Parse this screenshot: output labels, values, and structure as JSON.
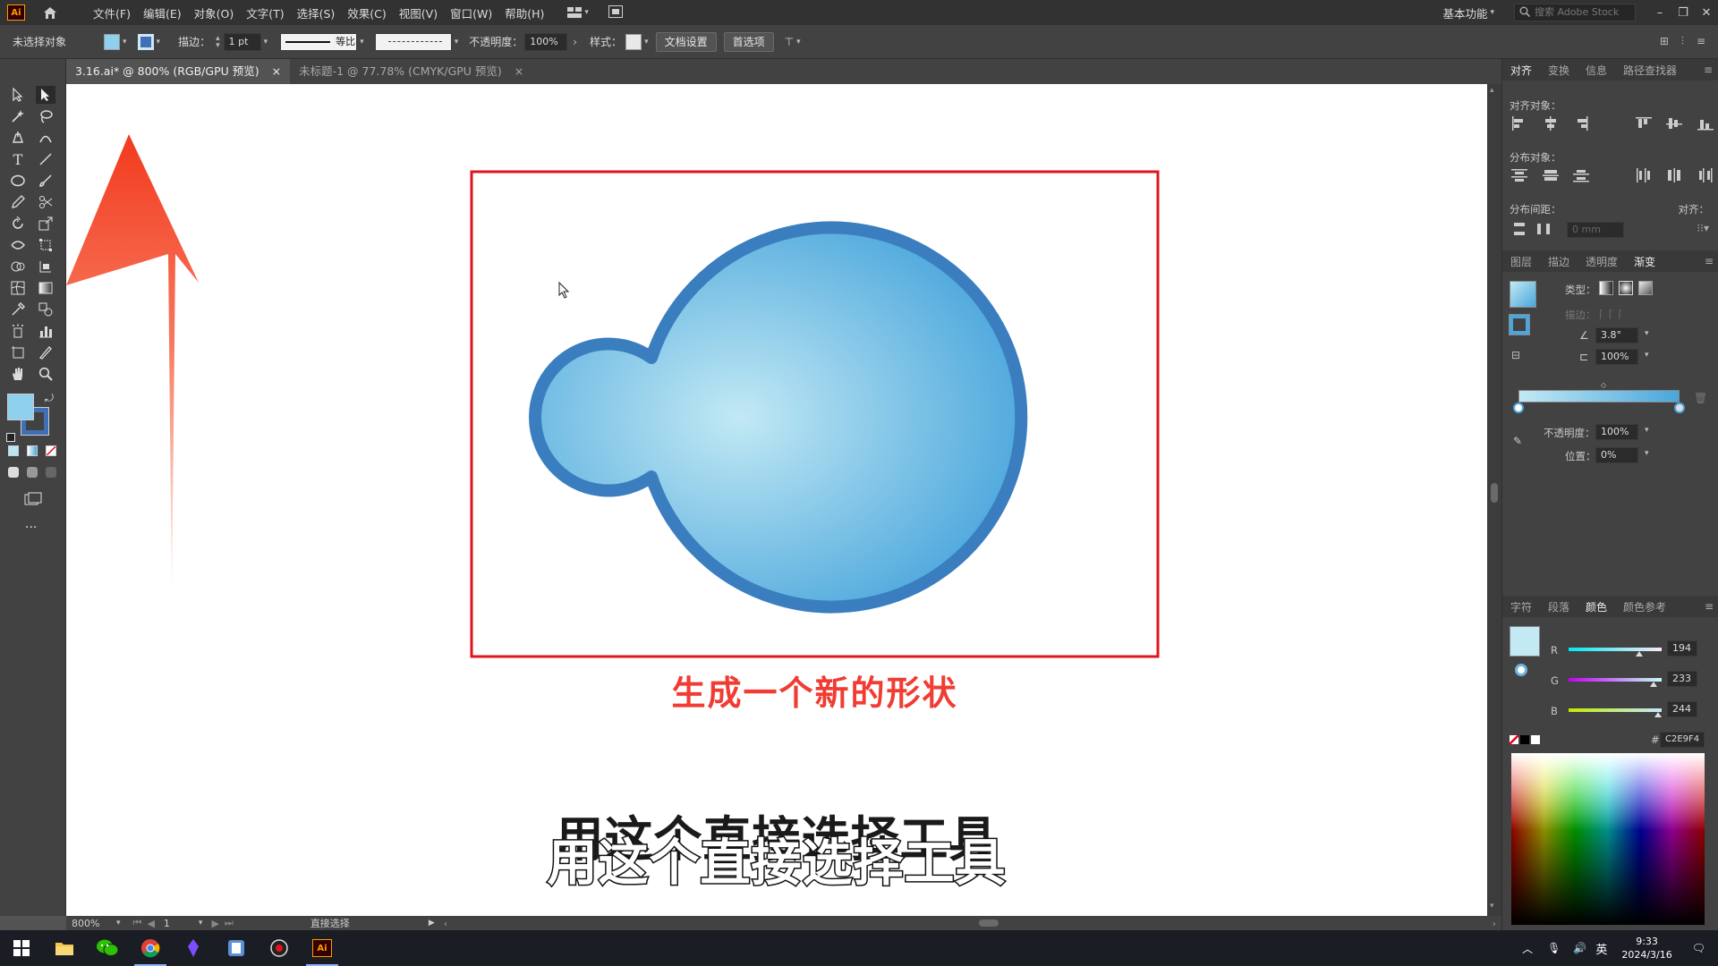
{
  "app": {
    "logo": "Ai"
  },
  "menu": [
    "文件(F)",
    "编辑(E)",
    "对象(O)",
    "文字(T)",
    "选择(S)",
    "效果(C)",
    "视图(V)",
    "窗口(W)",
    "帮助(H)"
  ],
  "menubar_right": {
    "workspace": "基本功能",
    "search_placeholder": "搜索 Adobe Stock"
  },
  "control_bar": {
    "selection_status": "未选择对象",
    "stroke_label": "描边：",
    "stroke_value": "1 pt",
    "profile_label": "等比",
    "opacity_label": "不透明度：",
    "opacity_value": "100%",
    "style_label": "样式：",
    "doc_setup_button": "文档设置",
    "preferences_button": "首选项"
  },
  "tabs": [
    {
      "label": "3.16.ai* @ 800% (RGB/GPU 预览)",
      "close": "×"
    },
    {
      "label": "未标题-1 @ 77.78% (CMYK/GPU 预览)",
      "close": "×"
    }
  ],
  "canvas": {
    "caption": "生成一个新的形状",
    "subtitle_top": "用这个直接选择工具",
    "subtitle_bottom": "用这个直接选择工具",
    "colors": {
      "frame": "#e0141e",
      "shape_stroke": "#3a7ebf",
      "shape_fill_light": "#c2e9f4",
      "shape_fill_dark": "#4aa6dc",
      "arrow_top": "#f23a1e",
      "caption": "#f03c32"
    }
  },
  "status_bar": {
    "zoom": "800%",
    "artboard": "1",
    "tool_name": "直接选择"
  },
  "align_panel": {
    "tabs": [
      "对齐",
      "变换",
      "信息",
      "路径查找器"
    ],
    "align_objects_label": "对齐对象：",
    "distribute_objects_label": "分布对象：",
    "distribute_spacing_label": "分布间距：",
    "align_to_label": "对齐：",
    "spacing_value": "0 mm"
  },
  "gradient_panel": {
    "tabs": [
      "图层",
      "描边",
      "透明度",
      "渐变"
    ],
    "type_label": "类型：",
    "stroke_label": "描边：",
    "angle_value": "3.8°",
    "aspect_value": "100%",
    "opacity_label": "不透明度：",
    "opacity_value": "100%",
    "location_label": "位置：",
    "location_value": "0%"
  },
  "color_panel": {
    "tabs": [
      "字符",
      "段落",
      "颜色",
      "颜色参考"
    ],
    "channels": [
      {
        "label": "R",
        "value": "194",
        "level": 0.76
      },
      {
        "label": "G",
        "value": "233",
        "level": 0.91
      },
      {
        "label": "B",
        "value": "244",
        "level": 0.96
      }
    ],
    "hex_label": "#",
    "hex_value": "C2E9F4",
    "current_color": "#c2e9f4"
  },
  "taskbar": {
    "time": "9:33",
    "date": "2024/3/16",
    "ime": "英",
    "apps": [
      "start-menu",
      "file-explorer",
      "wechat",
      "chrome",
      "vpn-app",
      "notes-app",
      "recorder-app",
      "illustrator"
    ]
  }
}
